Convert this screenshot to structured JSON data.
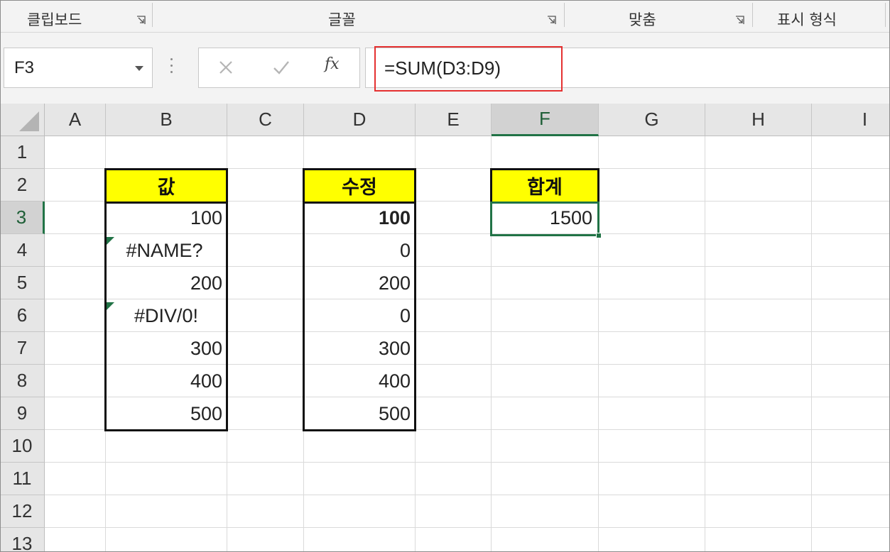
{
  "ribbon": {
    "groups": [
      {
        "label": "클립보드"
      },
      {
        "label": "글꼴"
      },
      {
        "label": "맞춤"
      },
      {
        "label": "표시 형식"
      }
    ]
  },
  "formula_bar": {
    "name_box": "F3",
    "formula": "=SUM(D3:D9)",
    "highlight_color": "#e53131"
  },
  "columns": [
    "A",
    "B",
    "C",
    "D",
    "E",
    "F",
    "G",
    "H",
    "I"
  ],
  "selected_column": "F",
  "rows": [
    "1",
    "2",
    "3",
    "4",
    "5",
    "6",
    "7",
    "8",
    "9",
    "10",
    "11",
    "12",
    "13"
  ],
  "selected_row": "3",
  "table_values": {
    "header": "값",
    "cells": [
      "100",
      "#NAME?",
      "200",
      "#DIV/0!",
      "300",
      "400",
      "500"
    ]
  },
  "table_fixed": {
    "header": "수정",
    "cells": [
      "100",
      "0",
      "200",
      "0",
      "300",
      "400",
      "500"
    ]
  },
  "total": {
    "header": "합계",
    "value": "1500"
  },
  "colors": {
    "header_fill": "#ffff00",
    "selection": "#217346",
    "error_indicator": "#217346"
  }
}
